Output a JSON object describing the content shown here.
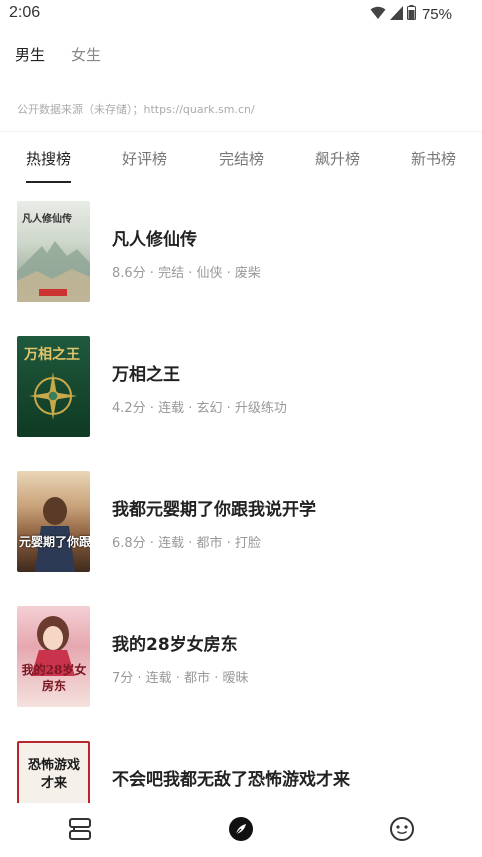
{
  "status_bar": {
    "time": "2:06",
    "battery": "75%",
    "icons": [
      "wifi-icon",
      "signal-icon",
      "battery-icon"
    ]
  },
  "gender_tabs": [
    {
      "label": "男生",
      "active": true
    },
    {
      "label": "女生",
      "active": false
    }
  ],
  "source_note": "公开数据来源（未存储）；https://quark.sm.cn/",
  "rank_tabs": [
    {
      "label": "热搜榜",
      "active": true
    },
    {
      "label": "好评榜",
      "active": false
    },
    {
      "label": "完结榜",
      "active": false
    },
    {
      "label": "飙升榜",
      "active": false
    },
    {
      "label": "新书榜",
      "active": false
    }
  ],
  "books": [
    {
      "title": "凡人修仙传",
      "meta": "8.6分 · 完结 · 仙侠 · 废柴",
      "cover_text": "凡人修仙传"
    },
    {
      "title": "万相之王",
      "meta": "4.2分 · 连载 · 玄幻 · 升级练功",
      "cover_text": "万相之王"
    },
    {
      "title": "我都元婴期了你跟我说开学",
      "meta": "6.8分 · 连载 · 都市 · 打脸",
      "cover_text": "元婴期了你跟我说"
    },
    {
      "title": "我的28岁女房东",
      "meta": "7分 · 连载 · 都市 · 暧昧",
      "cover_text": "我的28岁女房东"
    },
    {
      "title": "不会吧我都无敌了恐怖游戏才来",
      "meta": "",
      "cover_text": "恐怖游戏才来"
    }
  ],
  "bottom_nav": [
    {
      "name": "bookshelf-icon"
    },
    {
      "name": "discover-icon",
      "active": true
    },
    {
      "name": "profile-face-icon"
    }
  ],
  "colors": {
    "text_primary": "#222222",
    "text_secondary": "#999999",
    "accent": "#222222"
  }
}
